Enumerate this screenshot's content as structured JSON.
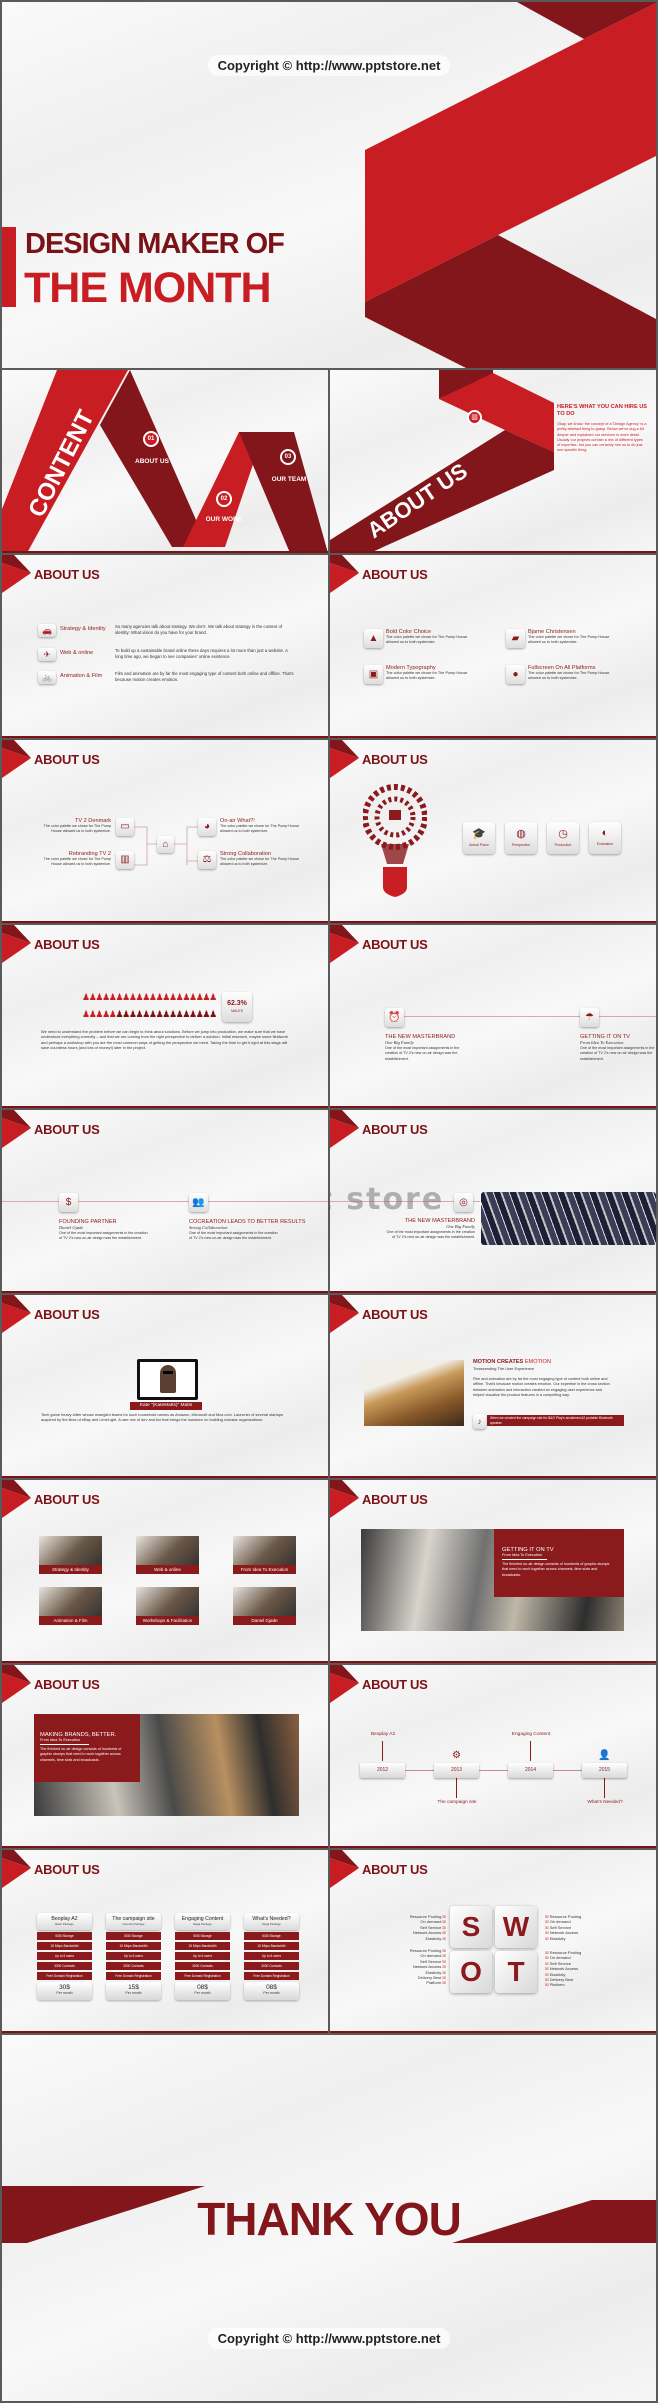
{
  "watermark": "Copyright © http://www.pptstore.net",
  "logo_watermark": "Ppt store",
  "colors": {
    "red": "#c81e23",
    "dark_red": "#82161a",
    "title_red": "#7d1216"
  },
  "title_slide": {
    "line1": "DESIGN MAKER OF",
    "line2": "THE MONTH"
  },
  "content_slide": {
    "title": "CONTENT",
    "items": [
      {
        "num": "01",
        "label": "ABOUT US"
      },
      {
        "num": "02",
        "label": "OUR WORK"
      },
      {
        "num": "03",
        "label": "OUR TEAM"
      }
    ]
  },
  "section_title": "ABOUT US",
  "about_intro": {
    "banner": "ABOUT US",
    "icon": "chart-icon",
    "heading": "HERE'S WHAT YOU CAN HIRE US TO DO",
    "body": "Okay, we know: the concept of a 'Design Agency' is a pretty abstract thing to grasp. Below we've dug a bit deeper and explained our services in more detail. Usually our projects contain a mix of different types of expertise, but you can certainly hire us to do just one specific thing."
  },
  "services": [
    {
      "icon": "🚗",
      "title": "Strategy & Identity",
      "text": "So many agencies talk about strategy. We don't. We talk about strategy in the context of identity: What vision do you have for your brand."
    },
    {
      "icon": "✈",
      "title": "Web & online",
      "text": "To build up a sustainable brand online these days requires a lot more than just a website. A long time ago, we began to see companies' online existence."
    },
    {
      "icon": "🚲",
      "title": "Animation & Film",
      "text": "Film and animation are by far the most engaging type of content both online and offline. That's because motion creates emotion."
    }
  ],
  "features": [
    {
      "icon": "▲",
      "title": "Bold Color Choice",
      "text": "The color palette we chose for The Pump House allowed us to both systemize."
    },
    {
      "icon": "▰",
      "title": "Bjarne Christensen",
      "text": "The color palette we chose for The Pump House allowed us to both systemize."
    },
    {
      "icon": "▣",
      "title": "Modern Typography",
      "text": "The color palette we chose for The Pump House allowed us to both systemize."
    },
    {
      "icon": "●",
      "title": "Fullscreen On All Platforms",
      "text": "The color palette we chose for The Pump House allowed us to both systemize."
    }
  ],
  "tree": {
    "center_icon": "⌂",
    "left": [
      {
        "icon": "▭",
        "title": "TV 2 Denmark",
        "text": "The color palette we chose for The Pump House allowed us to both systemize."
      },
      {
        "icon": "▥",
        "title": "Rebranding TV 2",
        "text": "The color palette we chose for The Pump House allowed us to both systemize."
      }
    ],
    "right": [
      {
        "icon": "◕",
        "title": "On-air What?!",
        "text": "The color palette we chose for The Pump House allowed us to both systemize."
      },
      {
        "icon": "⚖",
        "title": "Strong Collaboration",
        "text": "The color palette we chose for The Pump House allowed us to both systemize."
      }
    ]
  },
  "bulb": {
    "cards": [
      {
        "icon": "🎓",
        "label": "Actual Prace"
      },
      {
        "icon": "◍",
        "label": "Perspective"
      },
      {
        "icon": "◷",
        "label": "Production"
      },
      {
        "icon": "◐",
        "label": "Evaluation"
      }
    ]
  },
  "stats": {
    "value": "62.3%",
    "label": "MALES",
    "percent": 62.3,
    "body": "We need to understand the problem before we can begin to think about solutions. Before we jump into production, we make sure that we have understood everything correctly – and that we are coming from the right perspective to deliver a solution. Initial research, maybe some fieldwork and perhaps a workshop with you are the most common ways of getting the perspective we need. Taking the time to get it right at this stage will save countless hours (and lots of money!) later in the project."
  },
  "milestones": [
    {
      "icon": "⏰",
      "title": "THE NEW MASTERBRAND",
      "subtitle": "One Big Family",
      "text": "One of the most important assignments in the creation of TV 2's new on-air design was the establishment."
    },
    {
      "icon": "☂",
      "title": "GETTING IT ON TV",
      "subtitle": "From Idea To Execution",
      "text": "One of the most important assignments in the creation of TV 2's new on-air design was the establishment."
    }
  ],
  "partners": [
    {
      "icon": "$",
      "title": "FOUNDING PARTNER",
      "subtitle": "Daniel Gjøde",
      "text": "One of the most important assignments in the creation of TV 2's new on-air design was the establishment."
    },
    {
      "icon": "👥",
      "title": "COCREATION LEADS TO BETTER RESULTS",
      "subtitle": "Strong Collaboration",
      "text": "One of the most important assignments in the creation of TV 2's new on-air design was the establishment."
    }
  ],
  "masterbrand": {
    "icon": "◎",
    "title": "THE NEW MASTERBRAND",
    "subtitle": "One Big Family",
    "text": "One of the most important assignments in the creation of TV 2's new on-air design was the establishment."
  },
  "profile": {
    "name": "Kate \"(KateMatts)\" Matts",
    "bio": "Tech game heavy-hitter whose wrangled teams for such household names as Amazon, Microsoft and Moz.com. Launcher of several startups acquired by the likes of eBay and LimeLight. A rare mix of dev and biz that brings the lowdown on building rockstar organizations."
  },
  "motion": {
    "title_bold": "MOTION CREATES",
    "title_light": "EMOTION",
    "subtitle": "Transcending The User Experience",
    "body": "Film and animation are by far the most engaging type of content both online and offline. That's because motion creates emotion. Our expertise in the cross section between animation and interaction created an engaging user experience and helped visualize the product features in a compelling way.",
    "note": "When we created the campaign site for B&O Play's acclaimed A2 portable Bluetooth speaker."
  },
  "gallery": [
    "Strategy & Identity",
    "Web & online",
    "From Idea To Execution",
    "Animation & Film",
    "Workshops & Facilitation",
    "Daniel Gjøde"
  ],
  "tv_collage": {
    "title": "GETTING IT ON TV",
    "subtitle": "From Idea To Execution",
    "body": "The finished on-air design consists of hundreds of graphic stumps that need to work together across channels, time slots and broadcasts."
  },
  "brands_collage": {
    "title": "MAKING BRANDS, BETTER.",
    "subtitle": "From Idea To Execution",
    "body": "The finished on-air design consists of hundreds of graphic stumps that need to work together across channels, time slots and broadcasts."
  },
  "timeline": [
    {
      "year": "2012",
      "label": "Beoplay A2",
      "icon": ""
    },
    {
      "year": "2013",
      "label": "The campaign site",
      "icon": "⚙"
    },
    {
      "year": "2014",
      "label": "Engaging Content",
      "icon": ""
    },
    {
      "year": "2015",
      "label": "What's Needed?",
      "icon": "👤"
    }
  ],
  "pricing": [
    {
      "name": "Beoplay A2",
      "tier": "Basic Package",
      "features": [
        "5GB Storage",
        "15 Mbps Bandwidth",
        "Up to 6 users",
        "3000 Contacts",
        "Free Domain Registration"
      ],
      "price": "30$",
      "period": "Per month"
    },
    {
      "name": "The campaign site",
      "tier": "Favorite Package",
      "features": [
        "5GB Storage",
        "15 Mbps Bandwidth",
        "Up to 6 users",
        "3000 Contacts",
        "Free Domain Registration"
      ],
      "price": "15$",
      "period": "Per month"
    },
    {
      "name": "Engaging Content",
      "tier": "Mega Package",
      "features": [
        "5GB Storage",
        "15 Mbps Bandwidth",
        "Up to 6 users",
        "3000 Contacts",
        "Free Domain Registration"
      ],
      "price": "08$",
      "period": "Per month"
    },
    {
      "name": "What's Needed?",
      "tier": "Mega Package",
      "features": [
        "5GB Storage",
        "15 Mbps Bandwidth",
        "Up to 6 users",
        "3000 Contacts",
        "Free Domain Registration"
      ],
      "price": "08$",
      "period": "Per month"
    }
  ],
  "swot": {
    "letters": [
      "S",
      "W",
      "O",
      "T"
    ],
    "s": [
      "Resource Pooling",
      "On demand",
      "Self Service",
      "Network Access",
      "Elasticity"
    ],
    "w": [
      "Resource Pooling",
      "On demand",
      "Self Service",
      "Network Access",
      "Elasticity"
    ],
    "o": [
      "Resource Pooling",
      "On demand",
      "Self Service",
      "Network Access",
      "Elasticity",
      "Delivery Best",
      "Platform"
    ],
    "t": [
      "Resource Pooling",
      "On demand",
      "Self Service",
      "Network Access",
      "Elasticity",
      "Delivery Best",
      "Platform"
    ]
  },
  "closing": {
    "text": "THANK YOU"
  }
}
